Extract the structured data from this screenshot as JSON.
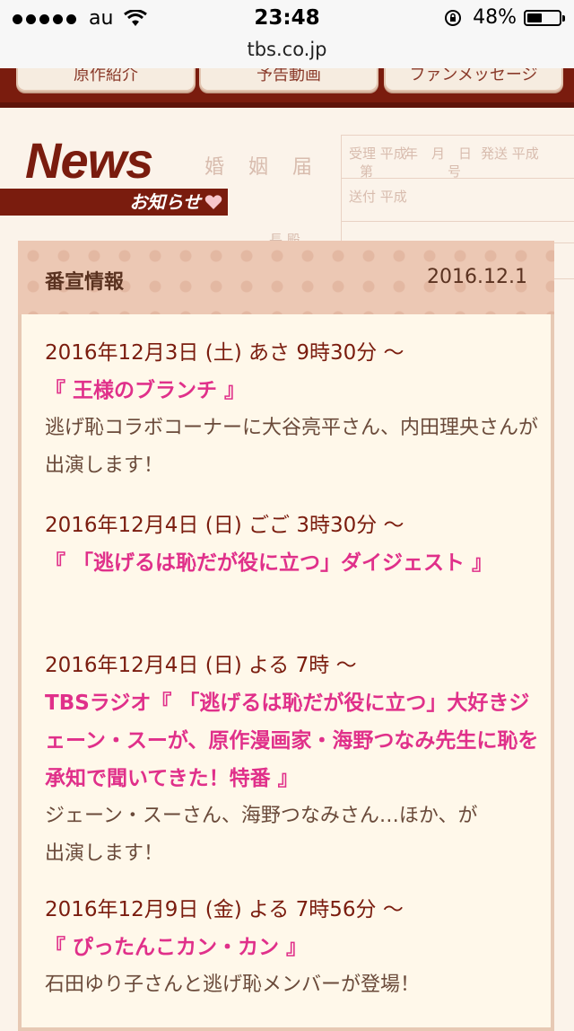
{
  "status_bar": {
    "carrier": "au",
    "time": "23:48",
    "battery_percent": "48%",
    "battery_level": 0.48
  },
  "browser": {
    "url": "tbs.co.jp"
  },
  "top_nav": {
    "items": [
      "原作紹介",
      "予告動画",
      "ファンメッセージ"
    ]
  },
  "news_header": {
    "title": "News",
    "subtitle": "お知らせ"
  },
  "background_form": {
    "title": "婚 姻 届",
    "labels": [
      "受理 平成",
      "年",
      "月",
      "日",
      "第",
      "号",
      "送付 平成",
      "長 殿",
      "発送 平成"
    ]
  },
  "panel": {
    "heading": "番宣情報",
    "date": "2016.12.1"
  },
  "items": [
    {
      "time": "2016年12月3日 (土) あさ 9時30分 〜",
      "title": "『 王様のブランチ 』",
      "description": "逃げ恥コラボコーナーに大谷亮平さん、内田理央さんが出演します！"
    },
    {
      "time": "2016年12月4日 (日) ごご 3時30分 〜",
      "title": "『 「逃げるは恥だが役に立つ」ダイジェスト 』",
      "description": ""
    },
    {
      "time": "2016年12月4日 (日) よる 7時 〜",
      "title": "TBSラジオ『 「逃げるは恥だが役に立つ」大好きジェーン・スーが、原作漫画家・海野つなみ先生に恥を承知で聞いてきた！特番 』",
      "description": "ジェーン・スーさん、海野つなみさん…ほか、が出演します！"
    },
    {
      "time": "2016年12月9日 (金) よる 7時56分 〜",
      "title": "『 ぴったんこカン・カン 』",
      "description": "石田ゆり子さんと逃げ恥メンバーが登場！"
    }
  ],
  "colors": {
    "brand_dark_red": "#7a1c0e",
    "title_pink": "#e0308a",
    "panel_bg": "#fff8ea",
    "header_bg": "#ecc8b4"
  },
  "icons": [
    "signal-dots-icon",
    "wifi-icon",
    "rotation-lock-icon",
    "battery-icon",
    "heart-icon"
  ]
}
